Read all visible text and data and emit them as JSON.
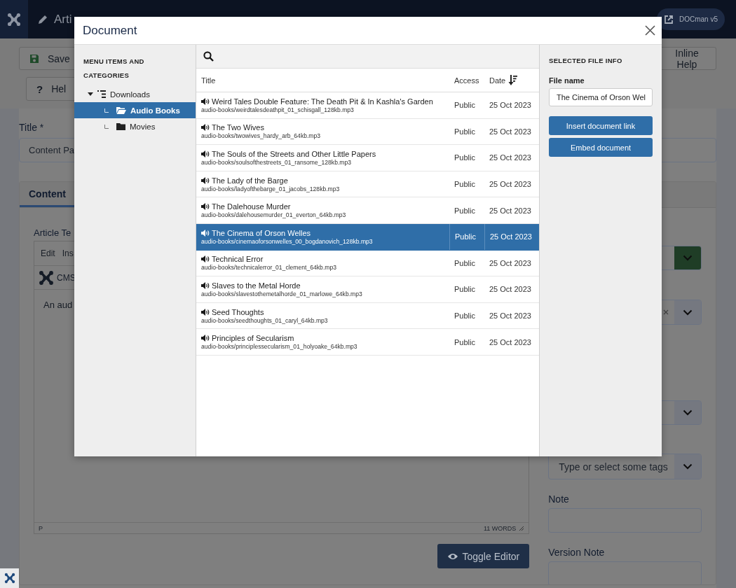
{
  "app_header": {
    "title": "Arti",
    "extension_button": "DOCman v5"
  },
  "toolbar": {
    "buttons": [
      {
        "kind": "save",
        "label": "Save"
      },
      {
        "kind": "help",
        "icon": "?",
        "label": "Hel"
      },
      {
        "kind": "plain",
        "label": "Inline Help"
      }
    ]
  },
  "form": {
    "title_label": "Title *",
    "title_value": "Content Pa",
    "tabs": [
      {
        "label": "Content",
        "selected": true
      }
    ],
    "article_text_label": "Article Te",
    "editor": {
      "menu": [
        "Edit",
        "Ins"
      ],
      "toolbar_label": "CMS",
      "content": "An aud",
      "status_path": "P",
      "word_count": "11 WORDS"
    },
    "toggle_button": "Toggle Editor"
  },
  "side_fields": [
    {
      "kind": "select-success"
    },
    {
      "kind": "select-clear"
    },
    {
      "kind": "select"
    },
    {
      "kind": "tags",
      "placeholder": "Type or select some tags"
    },
    {
      "kind": "text",
      "label": "Note"
    },
    {
      "kind": "text",
      "label": "Version Note"
    }
  ],
  "modal": {
    "title": "Document",
    "tree_heading": "MENU ITEMS AND CATEGORIES",
    "tree": [
      {
        "label": "Downloads",
        "expanded": true,
        "selected": false,
        "children": [
          {
            "label": "Audio Books",
            "selected": true
          },
          {
            "label": "Movies",
            "selected": false
          }
        ]
      }
    ],
    "columns": [
      "Title",
      "Access",
      "Date"
    ],
    "rows": [
      {
        "title": "Weird Tales Double Feature: The Death Pit & In Kashla's Garden",
        "path": "audio-books/weirdtalesdeathpit_01_schisgall_128kb.mp3",
        "access": "Public",
        "date": "25 Oct 2023",
        "selected": false
      },
      {
        "title": "The Two Wives",
        "path": "audio-books/twowives_hardy_arb_64kb.mp3",
        "access": "Public",
        "date": "25 Oct 2023",
        "selected": false
      },
      {
        "title": "The Souls of the Streets and Other Little Papers",
        "path": "audio-books/soulsofthestreets_01_ransome_128kb.mp3",
        "access": "Public",
        "date": "25 Oct 2023",
        "selected": false
      },
      {
        "title": "The Lady of the Barge",
        "path": "audio-books/ladyofthebarge_01_jacobs_128kb.mp3",
        "access": "Public",
        "date": "25 Oct 2023",
        "selected": false
      },
      {
        "title": "The Dalehouse Murder",
        "path": "audio-books/dalehousemurder_01_everton_64kb.mp3",
        "access": "Public",
        "date": "25 Oct 2023",
        "selected": false
      },
      {
        "title": "The Cinema of Orson Welles",
        "path": "audio-books/cinemaoforsonwelles_00_bogdanovich_128kb.mp3",
        "access": "Public",
        "date": "25 Oct 2023",
        "selected": true
      },
      {
        "title": "Technical Error",
        "path": "audio-books/technicalerror_01_clement_64kb.mp3",
        "access": "Public",
        "date": "25 Oct 2023",
        "selected": false
      },
      {
        "title": "Slaves to the Metal Horde",
        "path": "audio-books/slavestothemetalhorde_01_marlowe_64kb.mp3",
        "access": "Public",
        "date": "25 Oct 2023",
        "selected": false
      },
      {
        "title": "Seed Thoughts",
        "path": "audio-books/seedthoughts_01_caryl_64kb.mp3",
        "access": "Public",
        "date": "25 Oct 2023",
        "selected": false
      },
      {
        "title": "Principles of Secularism",
        "path": "audio-books/principlessecularism_01_holyoake_64kb.mp3",
        "access": "Public",
        "date": "25 Oct 2023",
        "selected": false
      }
    ],
    "info_heading": "SELECTED FILE INFO",
    "file_name_label": "File name",
    "file_name_value": "The Cinema of Orson Wel",
    "buttons": [
      "Insert document link",
      "Embed document"
    ]
  }
}
